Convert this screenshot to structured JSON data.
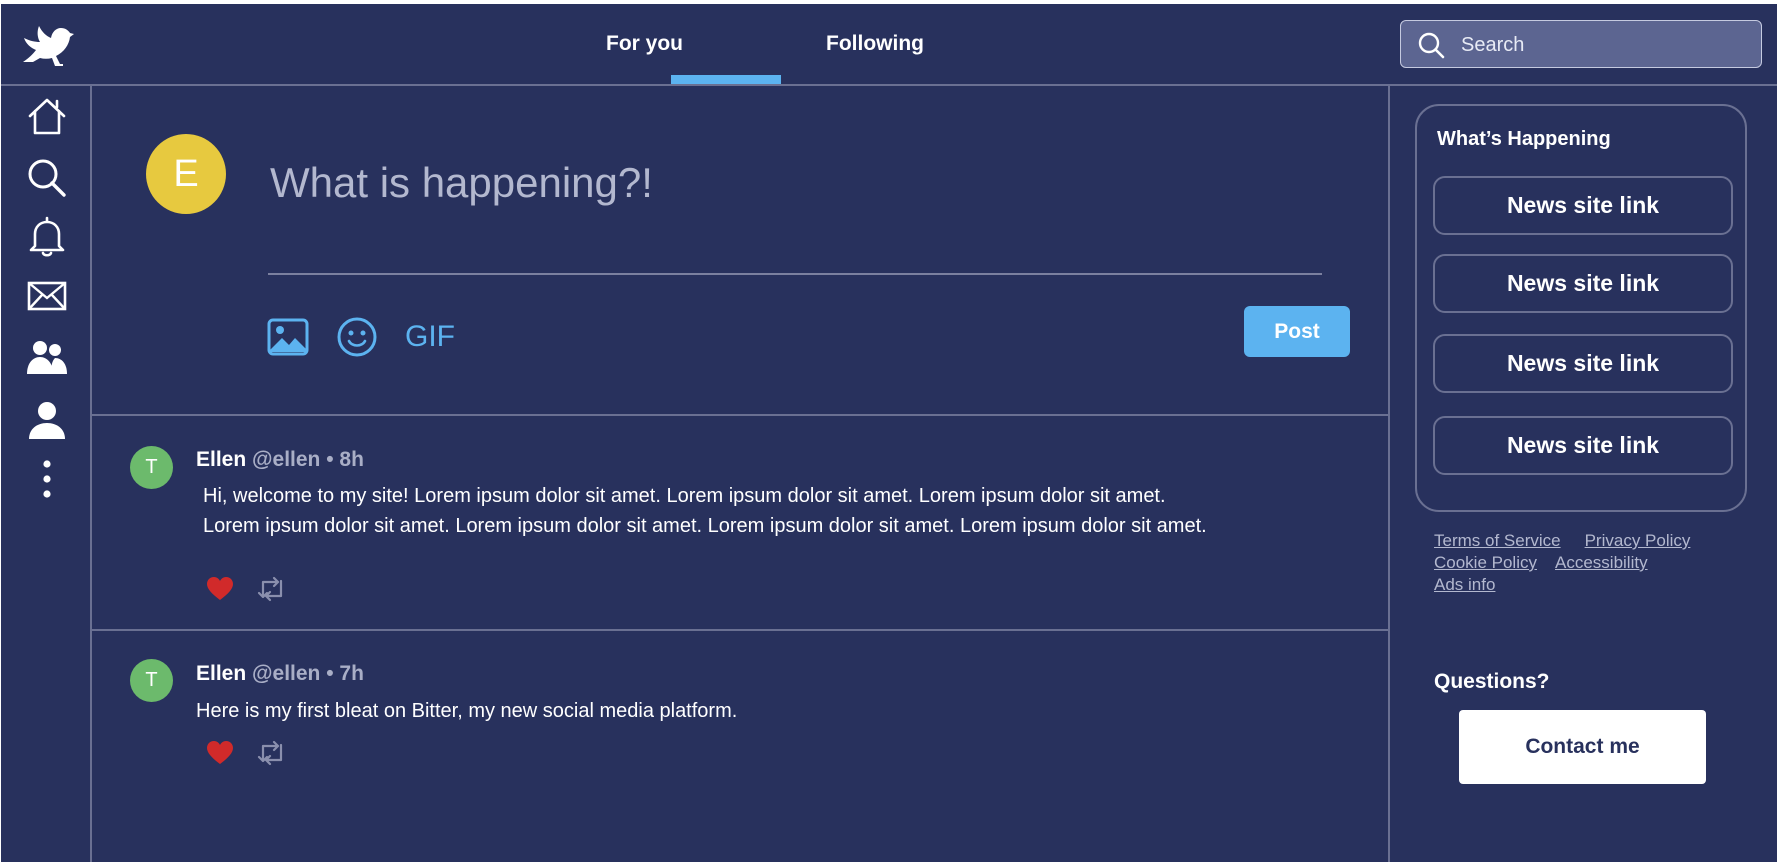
{
  "brand": {
    "logo_icon": "bird-logo-icon",
    "accent_color": "#5cb3f0",
    "background_color": "#28315d"
  },
  "header": {
    "tabs": [
      {
        "label": "For you",
        "active": true
      },
      {
        "label": "Following",
        "active": false
      }
    ],
    "search": {
      "placeholder": "Search",
      "icon": "search-icon"
    }
  },
  "sidebar": {
    "items": [
      {
        "name": "home",
        "icon": "home-icon"
      },
      {
        "name": "explore",
        "icon": "search-icon"
      },
      {
        "name": "notifications",
        "icon": "bell-icon"
      },
      {
        "name": "messages",
        "icon": "mail-icon"
      },
      {
        "name": "communities",
        "icon": "people-icon"
      },
      {
        "name": "profile",
        "icon": "user-icon"
      },
      {
        "name": "more",
        "icon": "more-vertical-icon"
      }
    ]
  },
  "composer": {
    "avatar_letter": "E",
    "avatar_color": "#e7c93f",
    "placeholder": "What is happening?!",
    "tools": [
      "image-icon",
      "emoji-icon"
    ],
    "gif_label": "GIF",
    "post_label": "Post"
  },
  "feed": {
    "posts": [
      {
        "avatar_letter": "T",
        "avatar_color": "#6cba6c",
        "name": "Ellen",
        "meta": "@ellen • 8h",
        "text": "Hi, welcome to my site! Lorem ipsum dolor sit amet. Lorem ipsum dolor sit amet. Lorem ipsum dolor sit amet. Lorem ipsum dolor sit amet. Lorem ipsum dolor sit amet. Lorem ipsum dolor sit amet. Lorem ipsum dolor sit amet.",
        "liked": true
      },
      {
        "avatar_letter": "T",
        "avatar_color": "#6cba6c",
        "name": "Ellen",
        "meta": "@ellen • 7h",
        "text": "Here is my first bleat on Bitter, my new social media platform.",
        "liked": true
      }
    ]
  },
  "whats_happening": {
    "title": "What’s Happening",
    "links": [
      "News site link",
      "News site link",
      "News site link",
      "News site link"
    ]
  },
  "footer_links": [
    "Terms of Service",
    "Privacy Policy",
    "Cookie Policy",
    "Accessibility",
    "Ads info"
  ],
  "questions": {
    "title": "Questions?",
    "button_label": "Contact me"
  }
}
